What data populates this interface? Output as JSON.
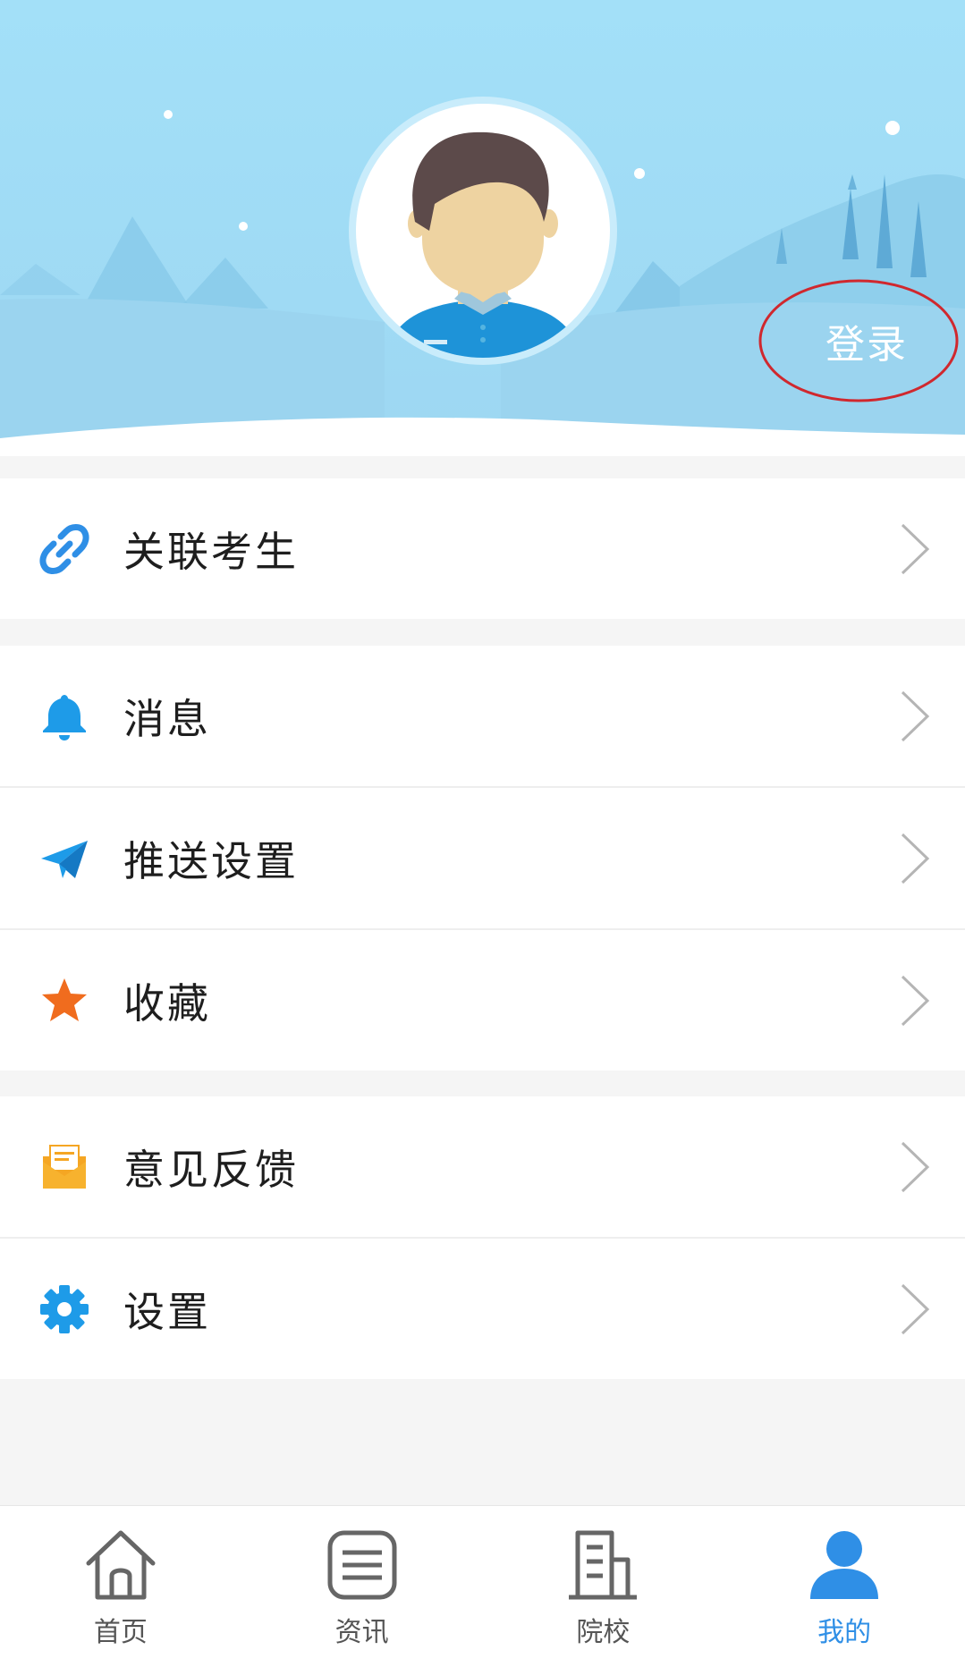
{
  "header": {
    "login_label": "登录"
  },
  "menu_groups": [
    {
      "items": [
        {
          "label": "关联考生",
          "icon": "link-icon",
          "color": "#2f8fe6"
        }
      ]
    },
    {
      "items": [
        {
          "label": "消息",
          "icon": "bell-icon",
          "color": "#1e9be8"
        },
        {
          "label": "推送设置",
          "icon": "paper-plane-icon",
          "color": "#1e9be8"
        },
        {
          "label": "收藏",
          "icon": "star-icon",
          "color": "#f06c1e"
        }
      ]
    },
    {
      "items": [
        {
          "label": "意见反馈",
          "icon": "feedback-mail-icon",
          "color": "#f5a623"
        },
        {
          "label": "设置",
          "icon": "gear-icon",
          "color": "#1e9be8"
        }
      ]
    }
  ],
  "tabbar": {
    "tabs": [
      {
        "label": "首页",
        "icon": "home-icon",
        "active": false
      },
      {
        "label": "资讯",
        "icon": "news-icon",
        "active": false
      },
      {
        "label": "院校",
        "icon": "school-building-icon",
        "active": false
      },
      {
        "label": "我的",
        "icon": "user-icon",
        "active": true
      }
    ],
    "active_color": "#2f8fe6",
    "inactive_color": "#555555"
  },
  "colors": {
    "header_sky": "#a3e0f8",
    "login_circle": "#d0282e",
    "page_background": "#f5f5f5"
  }
}
